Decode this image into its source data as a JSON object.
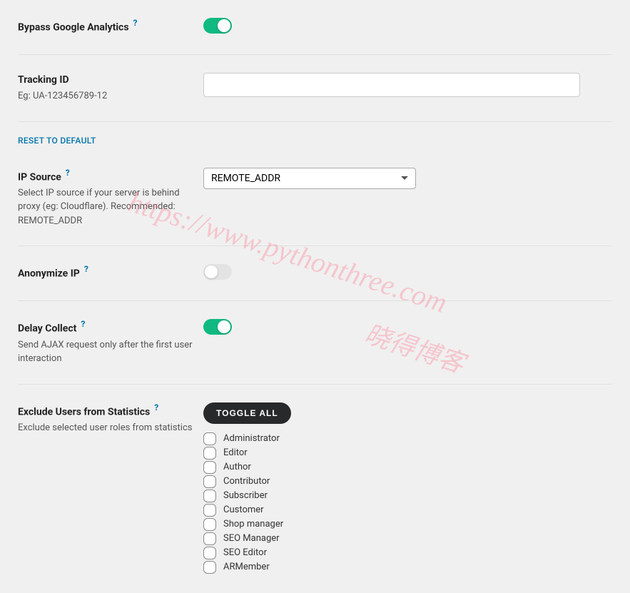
{
  "bypass": {
    "label": "Bypass Google Analytics",
    "enabled": true
  },
  "tracking": {
    "label": "Tracking ID",
    "description": "Eg: UA-123456789-12",
    "value": ""
  },
  "reset_link": "RESET TO DEFAULT",
  "ip_source": {
    "label": "IP Source",
    "description": "Select IP source if your server is behind proxy (eg: Cloudflare). Recommended: REMOTE_ADDR",
    "selected": "REMOTE_ADDR"
  },
  "anonymize": {
    "label": "Anonymize IP",
    "enabled": false
  },
  "delay": {
    "label": "Delay Collect",
    "description": "Send AJAX request only after the first user interaction",
    "enabled": true
  },
  "exclude": {
    "label": "Exclude Users from Statistics",
    "description": "Exclude selected user roles from statistics",
    "toggle_all": "TOGGLE ALL",
    "roles": [
      "Administrator",
      "Editor",
      "Author",
      "Contributor",
      "Subscriber",
      "Customer",
      "Shop manager",
      "SEO Manager",
      "SEO Editor",
      "ARMember"
    ]
  },
  "watermark": {
    "url": "https://www.pythonthree.com",
    "blog_name": "晓得博客"
  }
}
